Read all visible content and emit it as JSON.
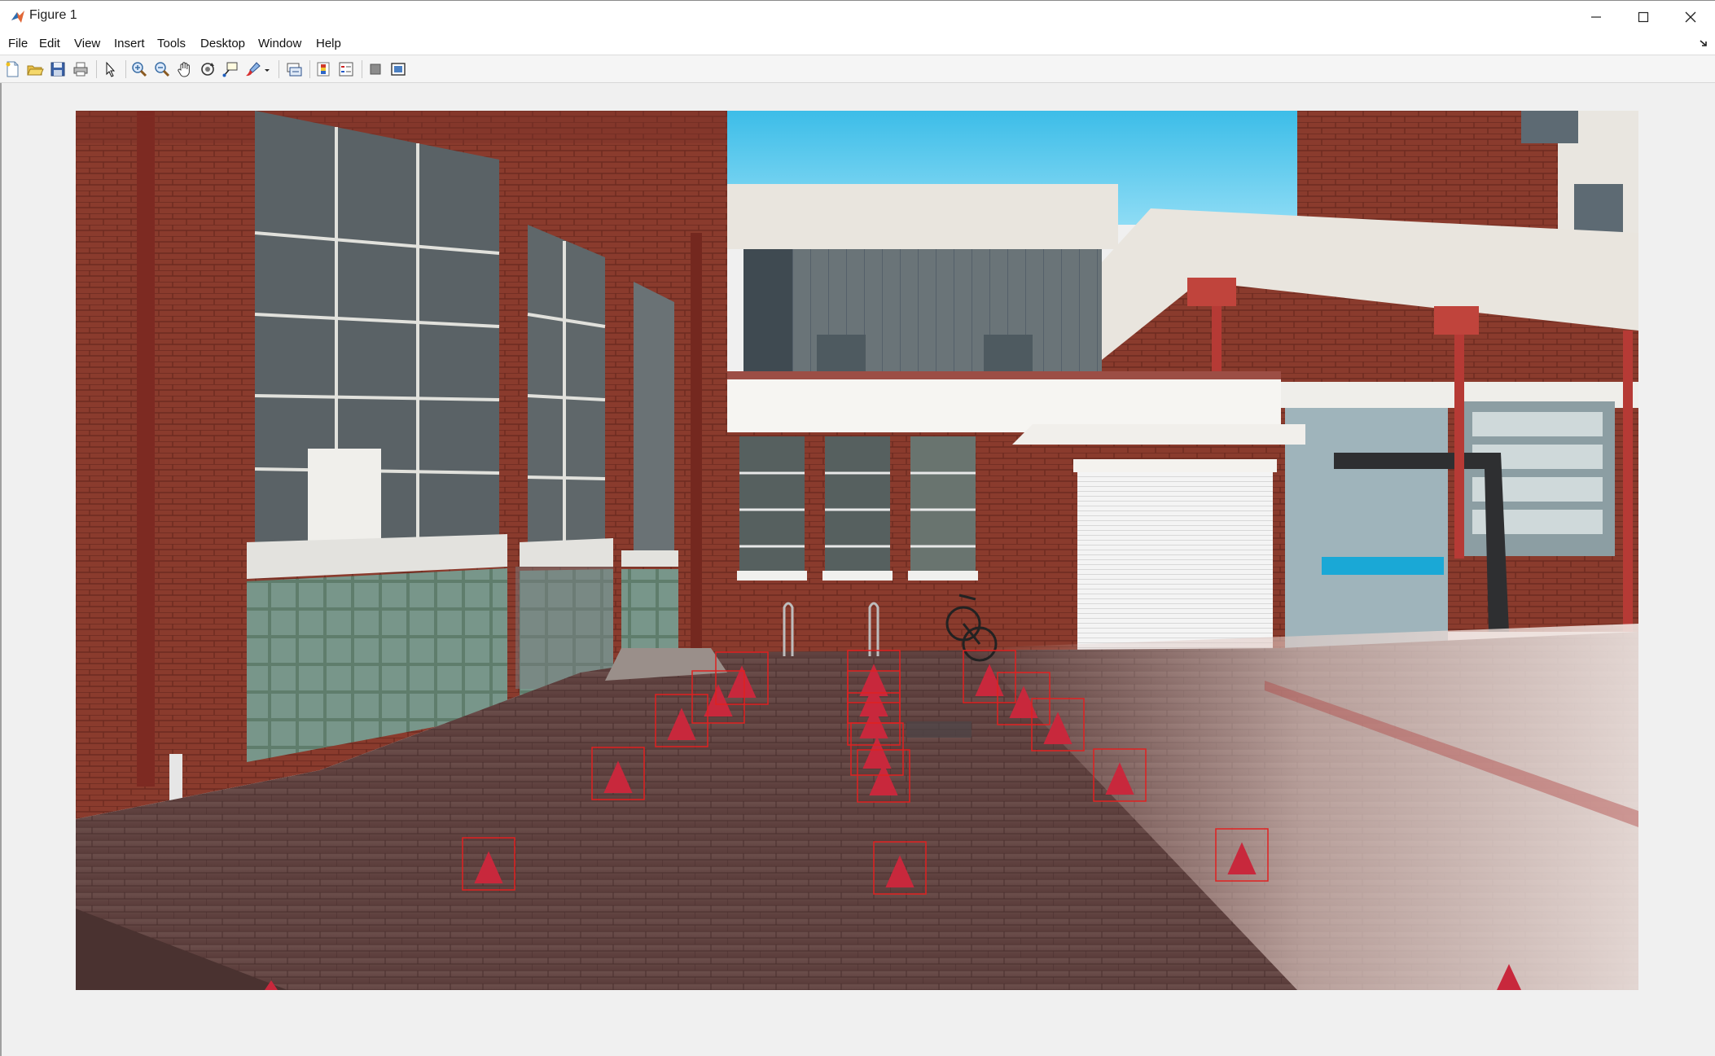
{
  "window": {
    "title": "Figure 1",
    "app_icon": "matlab-icon",
    "controls": [
      "minimize-icon",
      "maximize-icon",
      "close-icon"
    ]
  },
  "menu": {
    "items": [
      "File",
      "Edit",
      "View",
      "Insert",
      "Tools",
      "Desktop",
      "Window",
      "Help"
    ]
  },
  "toolbar": {
    "buttons": [
      "new-figure-icon",
      "open-file-icon",
      "save-icon",
      "print-icon",
      "edit-plot-arrow-icon",
      "zoom-in-icon",
      "zoom-out-icon",
      "pan-hand-icon",
      "rotate-3d-icon",
      "data-cursor-icon",
      "brush-icon",
      "brush-dropdown-icon",
      "link-plot-icon",
      "insert-colorbar-icon",
      "insert-legend-icon",
      "hide-plot-tools-icon",
      "show-plot-tools-icon"
    ]
  },
  "figure": {
    "image_content": "photo of brick courtyard with red traffic cones, each cone marked by a red detection bounding box",
    "box_color": "#e02020",
    "cone_color": "#c8283c"
  }
}
